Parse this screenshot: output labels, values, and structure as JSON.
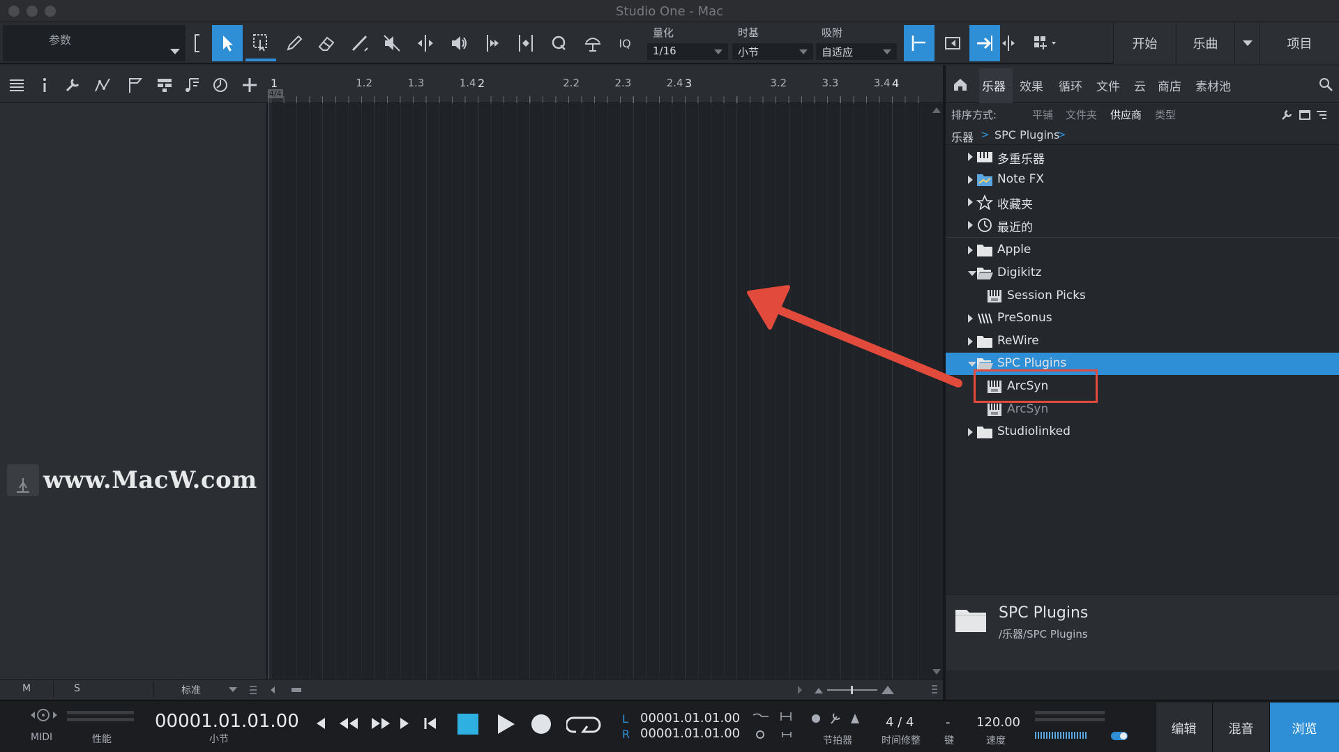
{
  "window": {
    "title": "Studio One - Mac"
  },
  "toolbar": {
    "params_label": "参数",
    "quantize": {
      "label": "量化",
      "value": "1/16"
    },
    "timebase": {
      "label": "时基",
      "value": "小节"
    },
    "snap": {
      "label": "吸附",
      "value": "自适应"
    },
    "iq_label": "IQ",
    "nav": {
      "start": "开始",
      "song": "乐曲",
      "project": "项目"
    }
  },
  "ruler": {
    "labels": [
      "1",
      "1.2",
      "1.3",
      "1.4",
      "2",
      "2.2",
      "2.3",
      "2.4",
      "3",
      "3.2",
      "3.3",
      "3.4",
      "4"
    ],
    "time_signature": "4/4"
  },
  "watermark": {
    "text": "www.MacW.com"
  },
  "bottom_strip": {
    "m": "M",
    "s": "S",
    "mode": "标准"
  },
  "browser": {
    "tabs": [
      "乐器",
      "效果",
      "循环",
      "文件",
      "云",
      "商店",
      "素材池"
    ],
    "active_tab": "乐器",
    "sort_label": "排序方式:",
    "sort_options": [
      "平铺",
      "文件夹",
      "供应商",
      "类型"
    ],
    "active_sort": "供应商",
    "breadcrumb": [
      "乐器",
      "SPC Plugins"
    ],
    "tree": [
      {
        "label": "多重乐器",
        "icon": "multi-instrument-icon",
        "expand": "closed",
        "indent": 0
      },
      {
        "label": "Note FX",
        "icon": "note-fx-folder-icon",
        "expand": "closed",
        "indent": 0
      },
      {
        "label": "收藏夹",
        "icon": "star-icon",
        "expand": "closed",
        "indent": 0
      },
      {
        "label": "最近的",
        "icon": "clock-icon",
        "expand": "closed",
        "indent": 0
      },
      {
        "label": "Apple",
        "icon": "folder-icon",
        "expand": "closed",
        "indent": 0
      },
      {
        "label": "Digikitz",
        "icon": "folder-open-icon",
        "expand": "open",
        "indent": 0
      },
      {
        "label": "Session Picks",
        "icon": "plugin-icon",
        "expand": "none",
        "indent": 1
      },
      {
        "label": "PreSonus",
        "icon": "presonus-icon",
        "expand": "closed",
        "indent": 0
      },
      {
        "label": "ReWire",
        "icon": "folder-icon",
        "expand": "closed",
        "indent": 0
      },
      {
        "label": "SPC Plugins",
        "icon": "folder-open-icon",
        "expand": "open",
        "indent": 0,
        "selected": true
      },
      {
        "label": "ArcSyn",
        "icon": "plugin-icon",
        "expand": "none",
        "indent": 1
      },
      {
        "label": "ArcSyn",
        "icon": "plugin-icon",
        "expand": "none",
        "indent": 1,
        "dim": true
      },
      {
        "label": "Studiolinked",
        "icon": "folder-icon",
        "expand": "closed",
        "indent": 0
      }
    ],
    "footer": {
      "title": "SPC Plugins",
      "path": "/乐器/SPC Plugins"
    }
  },
  "transport": {
    "midi_label": "MIDI",
    "perf_label": "性能",
    "position": "00001.01.01.00",
    "position_unit": "小节",
    "loop_l_label": "L",
    "loop_l": "00001.01.01.00",
    "loop_r_label": "R",
    "loop_r": "00001.01.01.00",
    "metronome_label": "节拍器",
    "time_sig": "4 / 4",
    "time_sig_label": "时间修整",
    "key": "-",
    "key_label": "键",
    "tempo": "120.00",
    "tempo_label": "速度",
    "modes": [
      "编辑",
      "混音",
      "浏览"
    ],
    "active_mode": "浏览"
  },
  "colors": {
    "accent": "#2e8fd6",
    "annotation": "#e24a3b"
  }
}
